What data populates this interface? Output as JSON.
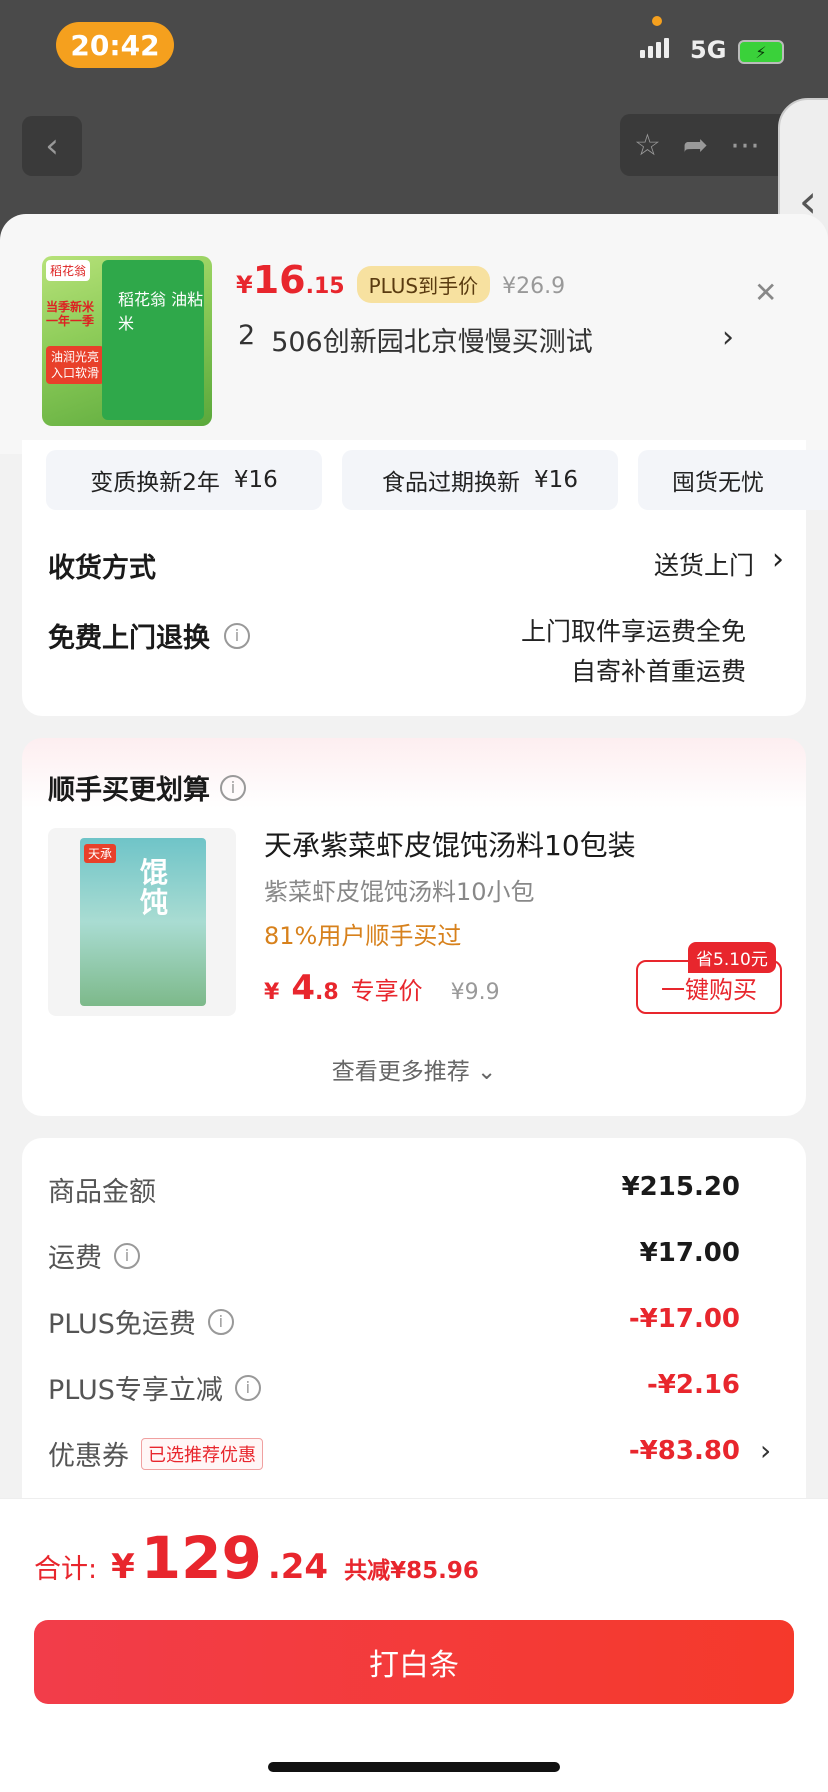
{
  "status_bar": {
    "time": "20:42",
    "network": "5G"
  },
  "product": {
    "price_yen": "¥",
    "price_int": "16",
    "price_dec": ".15",
    "plus_tag": "PLUS到手价",
    "original_price": "¥26.9",
    "quantity": "2",
    "address": "506创新园北京慢慢买测试",
    "image_labels": {
      "brand": "稻花翁",
      "slogan": "当季新米 一年一季",
      "promo": "油润光亮 入口软滑",
      "bag_text": "稻花翁 油粘米"
    }
  },
  "services": [
    {
      "label": "变质换新2年",
      "price": "¥16"
    },
    {
      "label": "食品过期换新",
      "price": "¥16"
    },
    {
      "label": "囤货无忧",
      "price": ""
    }
  ],
  "delivery": {
    "label": "收货方式",
    "value": "送货上门"
  },
  "returns": {
    "label": "免费上门退换",
    "line1": "上门取件享运费全免",
    "line2": "自寄补首重运费"
  },
  "recommend": {
    "title": "顺手买更划算",
    "name": "天承紫菜虾皮馄饨汤料10包装",
    "subtitle": "紫菜虾皮馄饨汤料10小包",
    "buyers": "81%用户顺手买过",
    "price_yen": "¥",
    "price_int": "4",
    "price_dec": ".8",
    "price_label": "专享价",
    "original_price": "¥9.9",
    "save_badge": "省5.10元",
    "buy_label": "一键购买",
    "more_label": "查看更多推荐",
    "image_labels": {
      "brand": "天承",
      "big": "馄饨"
    }
  },
  "fees": [
    {
      "label": "商品金额",
      "value": "¥215.20",
      "info": false,
      "red": false
    },
    {
      "label": "运费",
      "value": "¥17.00",
      "info": true,
      "red": false
    },
    {
      "label": "PLUS免运费",
      "value": "-¥17.00",
      "info": true,
      "red": true
    },
    {
      "label": "PLUS专享立减",
      "value": "-¥2.16",
      "info": true,
      "red": true
    },
    {
      "label": "优惠券",
      "value": "-¥83.80",
      "info": false,
      "red": true,
      "tag": "已选推荐优惠"
    }
  ],
  "total": {
    "label": "合计:",
    "yen": "¥",
    "int": "129",
    "dec": ".24",
    "saved": "共减¥85.96"
  },
  "pay_button": "打白条"
}
